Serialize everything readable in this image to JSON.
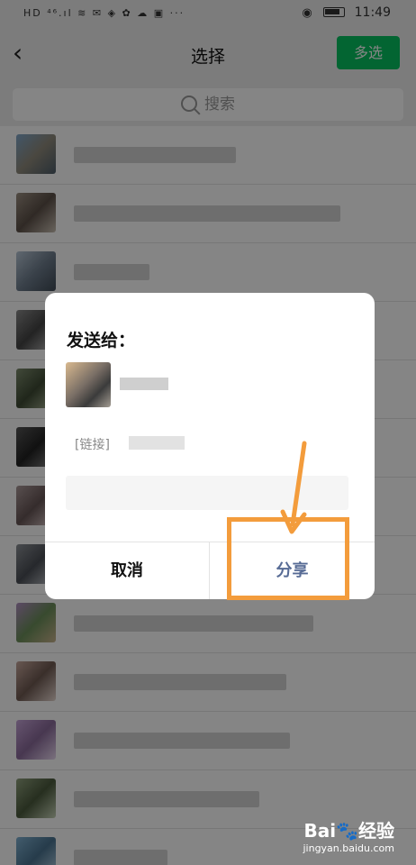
{
  "status_bar": {
    "left": "HD ⁴⁶.ıl ≋ ✉ ◈ ✿ ☁ ▣ ···",
    "eye_icon": "eye-icon",
    "time": "11:49"
  },
  "nav": {
    "back_icon": "chevron-left-icon",
    "title": "选择",
    "multi_select": "多选"
  },
  "search": {
    "placeholder": "搜索",
    "icon": "search-icon"
  },
  "dialog": {
    "title": "发送给：",
    "link_prefix": "[链接]",
    "cancel": "取消",
    "share": "分享"
  },
  "watermark": {
    "logo": "Bai🐾经验",
    "url": "jingyan.baidu.com"
  },
  "colors": {
    "accent_green": "#07c160",
    "share_blue": "#576b95",
    "annotation_orange": "#f39c3c"
  }
}
